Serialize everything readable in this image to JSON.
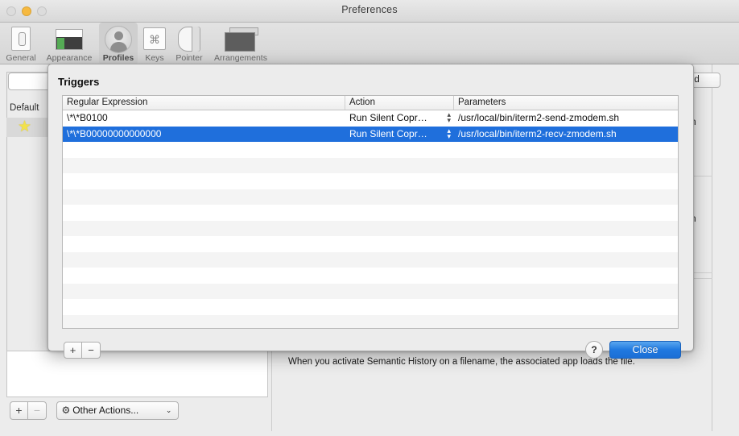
{
  "window": {
    "title": "Preferences",
    "traffic_lights": [
      "close",
      "minimize",
      "zoom"
    ]
  },
  "toolbar": {
    "items": [
      {
        "label": "General",
        "icon": "general-icon",
        "selected": false
      },
      {
        "label": "Appearance",
        "icon": "appearance-icon",
        "selected": false
      },
      {
        "label": "Profiles",
        "icon": "profiles-icon",
        "selected": true
      },
      {
        "label": "Keys",
        "icon": "keys-icon",
        "glyph": "⌘",
        "selected": false
      },
      {
        "label": "Pointer",
        "icon": "pointer-icon",
        "selected": false
      },
      {
        "label": "Arrangements",
        "icon": "arrangements-icon",
        "selected": false
      }
    ]
  },
  "sidebar": {
    "search_placeholder": "",
    "group_header": "Default",
    "star_glyph": "★"
  },
  "background": {
    "semantic_history_note": "When you activate Semantic History on a filename, the associated app loads the file.",
    "partial_badge": "ed",
    "partial_text_1": "n",
    "partial_text_2": "n",
    "add_label": "+",
    "remove_label": "−",
    "other_actions_label": "Other Actions...",
    "gear_glyph": "⚙",
    "caret_glyph": "⌄"
  },
  "dialog": {
    "title": "Triggers",
    "columns": [
      {
        "key": "regex",
        "label": "Regular Expression"
      },
      {
        "key": "action",
        "label": "Action"
      },
      {
        "key": "params",
        "label": "Parameters"
      }
    ],
    "rows": [
      {
        "regex": "\\*\\*B0100",
        "action": "Run Silent Copr…",
        "params": "/usr/local/bin/iterm2-send-zmodem.sh",
        "selected": false
      },
      {
        "regex": "\\*\\*B00000000000000",
        "action": "Run Silent Copr…",
        "params": "/usr/local/bin/iterm2-recv-zmodem.sh",
        "selected": true
      }
    ],
    "empty_row_count": 12,
    "add_label": "+",
    "remove_label": "−",
    "help_label": "?",
    "close_label": "Close",
    "stepper_up": "▴",
    "stepper_down": "▾"
  },
  "colors": {
    "selection_blue": "#1f6fdc",
    "default_button_blue": "#2079e0",
    "window_bg": "#ececec",
    "table_bg": "#ffffff",
    "stripe": "#f4f4f4"
  }
}
